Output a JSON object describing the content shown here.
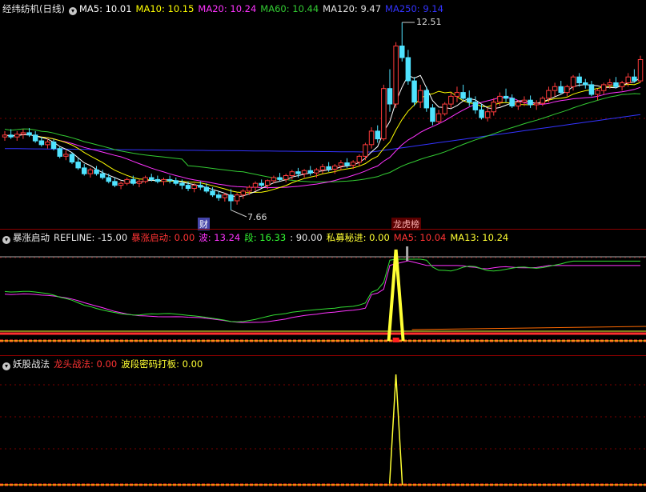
{
  "main_header": {
    "title": "经纬纺机(日线)",
    "ma5": "MA5: 10.01",
    "ma10": "MA10: 10.15",
    "ma20": "MA20: 10.24",
    "ma60": "MA60: 10.44",
    "ma120": "MA120: 9.47",
    "ma250": "MA250: 9.14"
  },
  "price_labels": {
    "high": "12.51",
    "low": "7.66"
  },
  "event_tags": {
    "fin": "财",
    "rank": "龙虎榜"
  },
  "ind1_header": {
    "title": "暴涨启动",
    "refline": "REFLINE: -15.00",
    "baozhang": "暴涨启动: 0.00",
    "bo": "波: 13.24",
    "duan": "段: 16.33",
    "ninety": ": 90.00",
    "simu": "私募秘进: 0.00",
    "ma5": "MA5: 10.04",
    "ma13": "MA13: 10.24"
  },
  "ind2_header": {
    "title": "妖股战法",
    "longtou": "龙头战法: 0.00",
    "boduan": "波段密码打板: 0.00"
  },
  "colors": {
    "up": "#ff3b3b",
    "down": "#4fe3ff",
    "ma5": "#ffffff",
    "ma10": "#ffff00",
    "ma20": "#ff33ff",
    "ma60": "#33cc33",
    "ma250": "#3333ff"
  },
  "chart_data": [
    {
      "type": "candlestick",
      "title": "经纬纺机(日线)",
      "ylim": [
        7.3,
        12.8
      ],
      "candles": [
        [
          9.55,
          9.7,
          9.45,
          9.6
        ],
        [
          9.6,
          9.75,
          9.5,
          9.55
        ],
        [
          9.55,
          9.7,
          9.45,
          9.62
        ],
        [
          9.62,
          9.75,
          9.5,
          9.66
        ],
        [
          9.66,
          9.78,
          9.55,
          9.6
        ],
        [
          9.6,
          9.7,
          9.4,
          9.45
        ],
        [
          9.45,
          9.55,
          9.3,
          9.35
        ],
        [
          9.35,
          9.5,
          9.25,
          9.42
        ],
        [
          9.42,
          9.5,
          9.2,
          9.25
        ],
        [
          9.25,
          9.3,
          9.0,
          9.05
        ],
        [
          9.05,
          9.2,
          8.95,
          9.1
        ],
        [
          9.1,
          9.15,
          8.85,
          8.9
        ],
        [
          8.9,
          9.0,
          8.7,
          8.75
        ],
        [
          8.75,
          8.85,
          8.55,
          8.6
        ],
        [
          8.6,
          8.75,
          8.5,
          8.7
        ],
        [
          8.7,
          8.8,
          8.55,
          8.6
        ],
        [
          8.6,
          8.7,
          8.45,
          8.5
        ],
        [
          8.5,
          8.6,
          8.35,
          8.4
        ],
        [
          8.4,
          8.5,
          8.25,
          8.3
        ],
        [
          8.3,
          8.4,
          8.2,
          8.35
        ],
        [
          8.35,
          8.5,
          8.3,
          8.45
        ],
        [
          8.45,
          8.55,
          8.3,
          8.35
        ],
        [
          8.35,
          8.45,
          8.25,
          8.4
        ],
        [
          8.4,
          8.55,
          8.35,
          8.5
        ],
        [
          8.5,
          8.6,
          8.4,
          8.45
        ],
        [
          8.45,
          8.55,
          8.35,
          8.4
        ],
        [
          8.4,
          8.5,
          8.3,
          8.45
        ],
        [
          8.45,
          8.55,
          8.35,
          8.42
        ],
        [
          8.42,
          8.5,
          8.3,
          8.35
        ],
        [
          8.35,
          8.45,
          8.2,
          8.3
        ],
        [
          8.3,
          8.4,
          8.15,
          8.22
        ],
        [
          8.22,
          8.35,
          8.12,
          8.3
        ],
        [
          8.3,
          8.4,
          8.18,
          8.25
        ],
        [
          8.25,
          8.35,
          8.1,
          8.15
        ],
        [
          8.15,
          8.25,
          8.0,
          8.05
        ],
        [
          8.05,
          8.15,
          7.9,
          7.98
        ],
        [
          7.98,
          8.1,
          7.88,
          8.05
        ],
        [
          8.05,
          8.2,
          7.66,
          7.9
        ],
        [
          7.9,
          8.1,
          7.8,
          8.05
        ],
        [
          8.05,
          8.2,
          7.95,
          8.15
        ],
        [
          8.15,
          8.3,
          8.05,
          8.25
        ],
        [
          8.25,
          8.4,
          8.15,
          8.35
        ],
        [
          8.35,
          8.45,
          8.25,
          8.3
        ],
        [
          8.3,
          8.45,
          8.2,
          8.42
        ],
        [
          8.42,
          8.55,
          8.35,
          8.5
        ],
        [
          8.5,
          8.62,
          8.4,
          8.45
        ],
        [
          8.45,
          8.6,
          8.38,
          8.55
        ],
        [
          8.55,
          8.7,
          8.45,
          8.65
        ],
        [
          8.65,
          8.75,
          8.5,
          8.6
        ],
        [
          8.6,
          8.72,
          8.5,
          8.68
        ],
        [
          8.68,
          8.8,
          8.55,
          8.62
        ],
        [
          8.62,
          8.75,
          8.5,
          8.7
        ],
        [
          8.7,
          8.85,
          8.6,
          8.78
        ],
        [
          8.78,
          8.9,
          8.65,
          8.72
        ],
        [
          8.72,
          8.85,
          8.6,
          8.8
        ],
        [
          8.8,
          8.95,
          8.7,
          8.88
        ],
        [
          8.88,
          9.0,
          8.75,
          8.82
        ],
        [
          8.82,
          8.95,
          8.72,
          8.9
        ],
        [
          8.9,
          9.1,
          8.8,
          9.05
        ],
        [
          9.05,
          9.4,
          8.95,
          9.35
        ],
        [
          9.35,
          9.8,
          9.25,
          9.7
        ],
        [
          9.7,
          9.85,
          9.4,
          9.5
        ],
        [
          9.5,
          10.9,
          9.45,
          10.8
        ],
        [
          10.8,
          11.3,
          10.2,
          10.4
        ],
        [
          10.4,
          12.0,
          10.3,
          11.9
        ],
        [
          11.9,
          12.51,
          11.5,
          11.6
        ],
        [
          11.6,
          11.8,
          10.9,
          11.0
        ],
        [
          11.0,
          11.1,
          10.35,
          10.45
        ],
        [
          10.45,
          10.9,
          10.3,
          10.75
        ],
        [
          10.75,
          10.85,
          10.2,
          10.3
        ],
        [
          10.3,
          10.4,
          9.85,
          9.95
        ],
        [
          9.95,
          10.25,
          9.9,
          10.15
        ],
        [
          10.15,
          10.45,
          10.1,
          10.4
        ],
        [
          10.4,
          10.7,
          10.3,
          10.6
        ],
        [
          10.6,
          10.85,
          10.45,
          10.7
        ],
        [
          10.7,
          10.9,
          10.5,
          10.55
        ],
        [
          10.55,
          10.75,
          10.35,
          10.45
        ],
        [
          10.45,
          10.6,
          10.15,
          10.25
        ],
        [
          10.25,
          10.4,
          10.0,
          10.05
        ],
        [
          10.05,
          10.3,
          9.95,
          10.2
        ],
        [
          10.2,
          10.55,
          10.1,
          10.45
        ],
        [
          10.45,
          10.7,
          10.35,
          10.6
        ],
        [
          10.6,
          10.8,
          10.45,
          10.55
        ],
        [
          10.55,
          10.65,
          10.3,
          10.35
        ],
        [
          10.35,
          10.5,
          10.25,
          10.45
        ],
        [
          10.45,
          10.6,
          10.35,
          10.5
        ],
        [
          10.5,
          10.62,
          10.3,
          10.38
        ],
        [
          10.38,
          10.5,
          10.25,
          10.42
        ],
        [
          10.42,
          10.6,
          10.35,
          10.55
        ],
        [
          10.55,
          10.85,
          10.45,
          10.75
        ],
        [
          10.75,
          10.95,
          10.6,
          10.85
        ],
        [
          10.85,
          11.0,
          10.65,
          10.7
        ],
        [
          10.7,
          10.9,
          10.6,
          10.85
        ],
        [
          10.85,
          11.15,
          10.75,
          11.1
        ],
        [
          11.1,
          11.2,
          10.85,
          10.95
        ],
        [
          10.95,
          11.05,
          10.8,
          10.9
        ],
        [
          10.9,
          11.0,
          10.6,
          10.65
        ],
        [
          10.65,
          10.8,
          10.5,
          10.75
        ],
        [
          10.75,
          10.95,
          10.65,
          10.9
        ],
        [
          10.9,
          11.05,
          10.8,
          10.95
        ],
        [
          10.95,
          11.1,
          10.8,
          10.85
        ],
        [
          10.85,
          11.0,
          10.75,
          10.95
        ],
        [
          10.95,
          11.2,
          10.85,
          11.1
        ],
        [
          11.1,
          11.3,
          10.95,
          11.0
        ],
        [
          11.0,
          11.65,
          10.95,
          11.55
        ]
      ]
    },
    {
      "type": "line",
      "title": "暴涨启动",
      "refline": -15.0,
      "lines": [
        "波",
        "段",
        "MA5",
        "MA13"
      ],
      "spike": {
        "series": "暴涨启动",
        "value": 100,
        "at_candle": 64
      }
    },
    {
      "type": "line",
      "title": "妖股战法",
      "spike": {
        "series": "波段密码打板",
        "value": 100,
        "at_candle": 64
      }
    }
  ]
}
